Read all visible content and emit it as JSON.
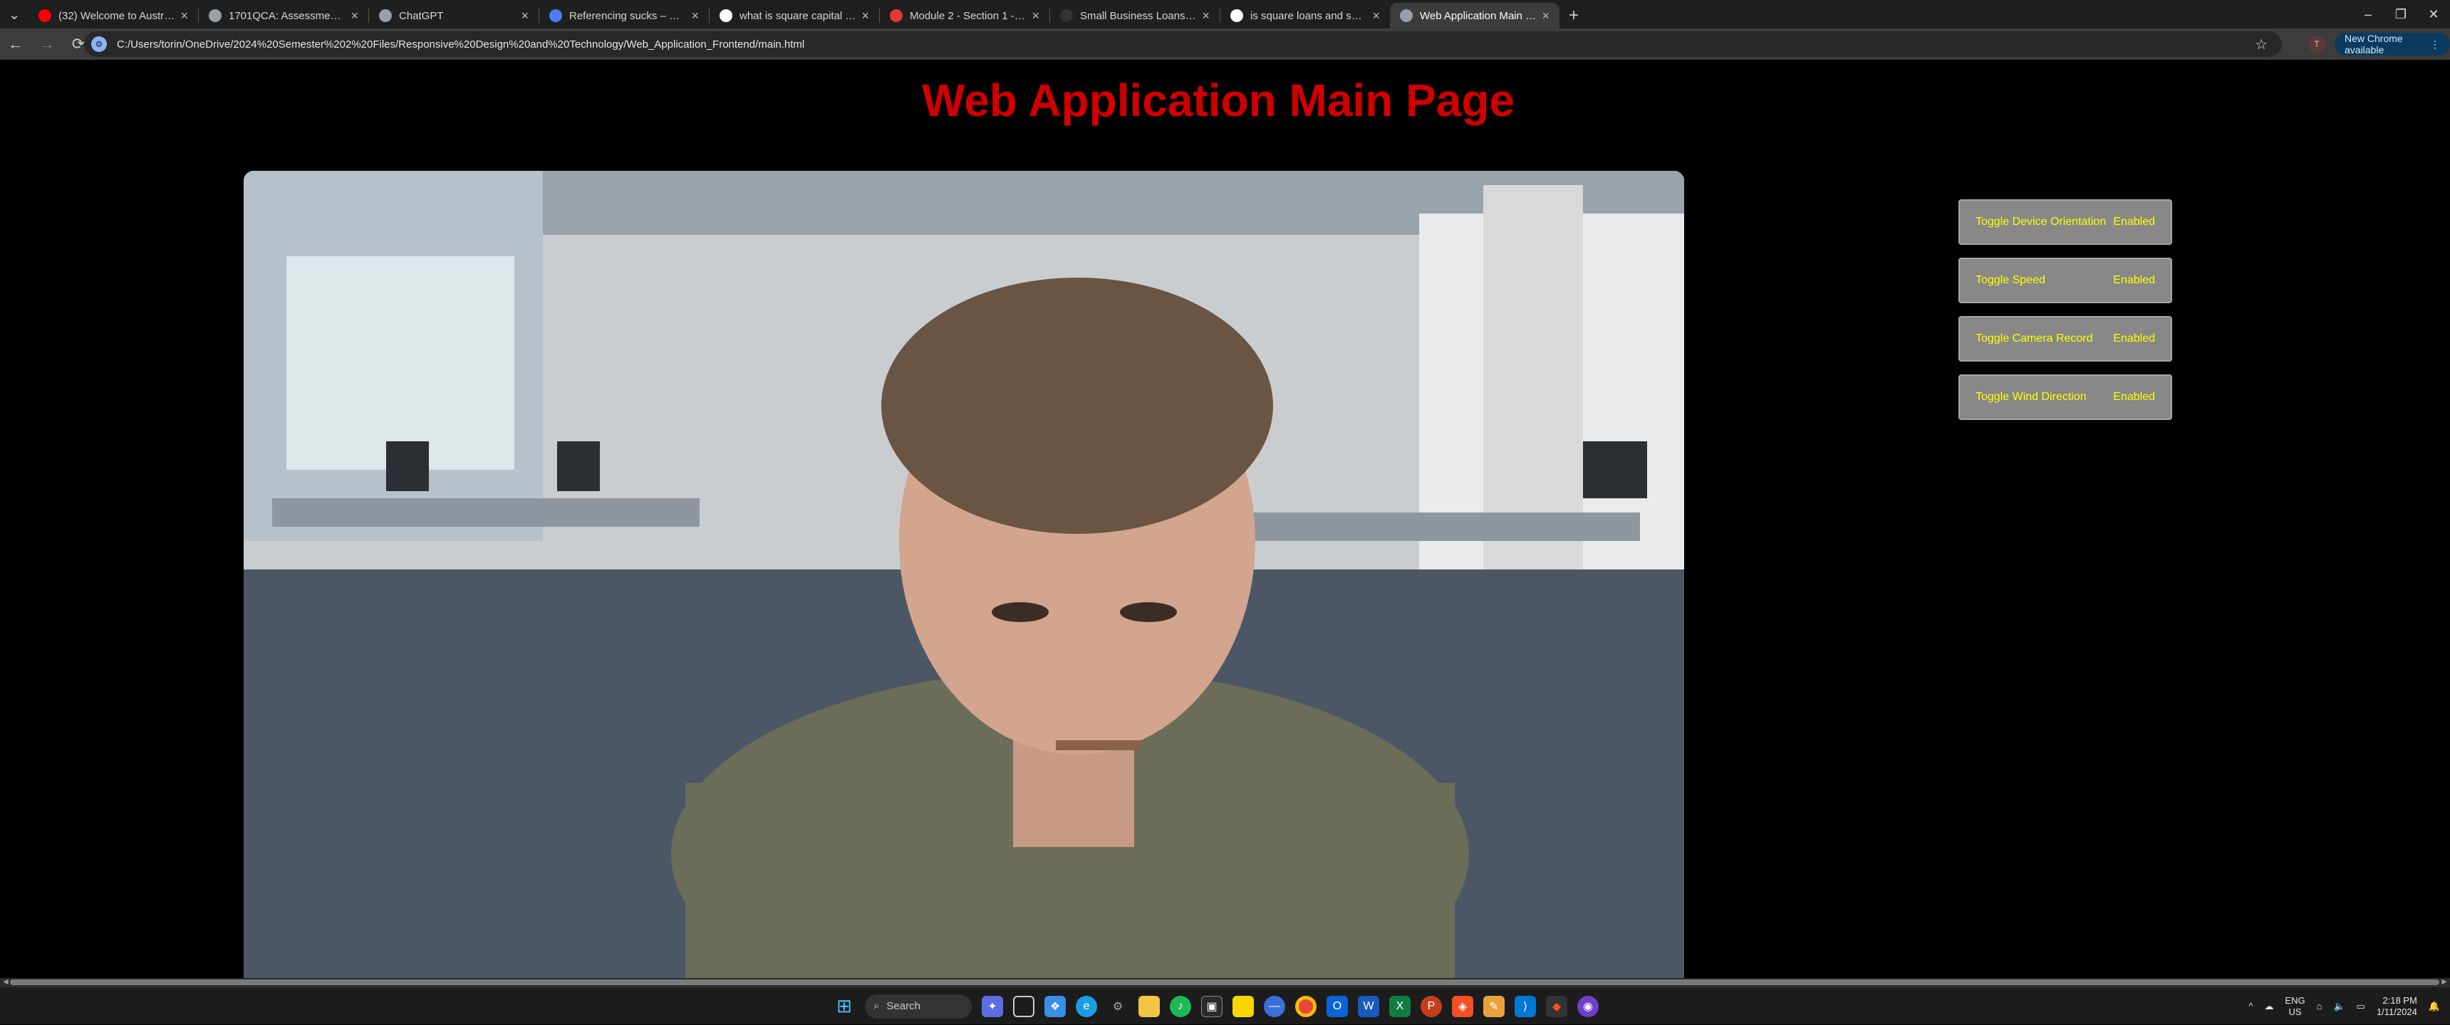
{
  "browser": {
    "tabs": [
      {
        "title": "(32) Welcome to Australia's M...",
        "icon": "youtube-icon",
        "color": "#ff0000",
        "active": false
      },
      {
        "title": "1701QCA: Assessment 3 | 1701...",
        "icon": "globe-icon",
        "color": "#9aa0a6",
        "active": false
      },
      {
        "title": "ChatGPT",
        "icon": "chatgpt-icon",
        "color": "#9aa0a6",
        "active": false
      },
      {
        "title": "Referencing sucks – MyBib",
        "icon": "bookmark-icon",
        "color": "#4c7cf3",
        "active": false
      },
      {
        "title": "what is square capital - Google",
        "icon": "google-icon",
        "color": "#ffffff",
        "active": false
      },
      {
        "title": "Module 2 - Section 1 - How (B)...",
        "icon": "circle-icon",
        "color": "#e53935",
        "active": false
      },
      {
        "title": "Small Business Loans & Busine...",
        "icon": "square-icon",
        "color": "#333333",
        "active": false
      },
      {
        "title": "is square loans and square cap...",
        "icon": "google-icon",
        "color": "#ffffff",
        "active": false
      },
      {
        "title": "Web Application Main Page",
        "icon": "globe-icon",
        "color": "#9aa0a6",
        "active": true
      }
    ],
    "address": "C:/Users/torin/OneDrive/2024%20Semester%202%20Files/Responsive%20Design%20and%20Technology/Web_Application_Frontend/main.html",
    "profile_initial": "T",
    "new_chrome_label": "New Chrome available"
  },
  "page": {
    "title": "Web Application Main Page",
    "controls": [
      {
        "label": "Toggle Device Orientation",
        "state": "Enabled"
      },
      {
        "label": "Toggle Speed",
        "state": "Enabled"
      },
      {
        "label": "Toggle Camera Record",
        "state": "Enabled"
      },
      {
        "label": "Toggle Wind Direction",
        "state": "Enabled"
      }
    ]
  },
  "taskbar": {
    "search_label": "Search",
    "lang": "ENG",
    "region": "US",
    "time": "2:18 PM",
    "date": "1/11/2024"
  }
}
